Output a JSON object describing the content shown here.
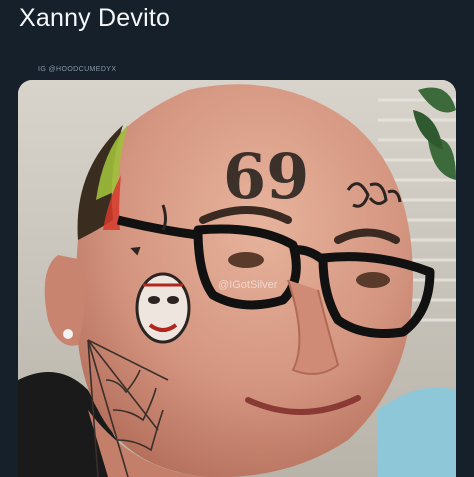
{
  "post": {
    "title": "Xanny Devito",
    "credit": "IG @HOODCUMEDYX"
  },
  "photo": {
    "forehead_tattoo": "69",
    "watermark": "@IGotSilver"
  },
  "colors": {
    "background": "#15202b",
    "title_text": "#f5f8fa",
    "credit_text": "#8899a6",
    "skin": "#d9a08a",
    "wall": "#c9c4ba"
  }
}
